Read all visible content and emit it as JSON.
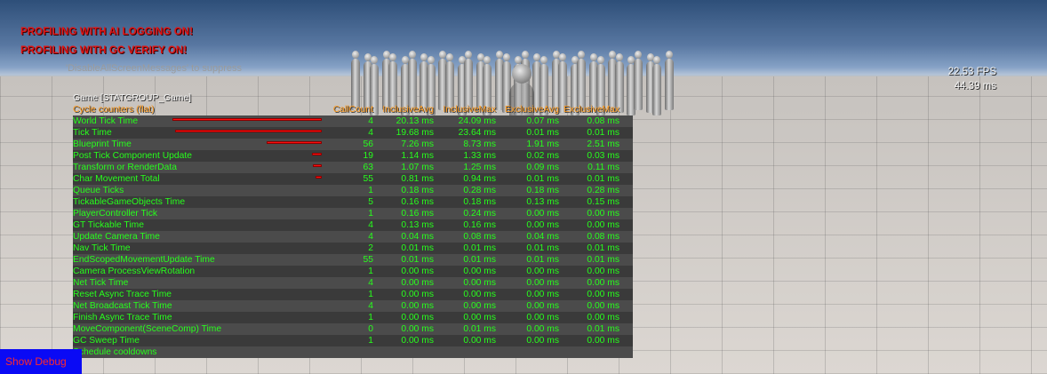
{
  "warnings": [
    "PROFILING WITH AI LOGGING ON!",
    "PROFILING WITH GC VERIFY ON!"
  ],
  "suppress_hint": "'DisableAllScreenMessages' to suppress",
  "fps": {
    "fps": "22.53 FPS",
    "ms": "44.39 ms"
  },
  "stats": {
    "group_title": "Game [STATGROUP_Game]",
    "headers": {
      "name": "Cycle counters (flat)",
      "callcount": "CallCount",
      "inclusive_avg": "InclusiveAvg",
      "inclusive_max": "InclusiveMax",
      "exclusive_avg": "ExclusiveAvg",
      "exclusive_max": "ExclusiveMax"
    },
    "colors": {
      "text": "#27ff1c",
      "header": "#ff9b1e",
      "bar": "#ff1010"
    },
    "rows": [
      {
        "name": "World Tick Time",
        "count": "4",
        "inc_avg": "20.13 ms",
        "inc_max": "24.09 ms",
        "exc_avg": "0.07 ms",
        "exc_max": "0.08 ms",
        "bar": 0.6
      },
      {
        "name": "Tick Time",
        "count": "4",
        "inc_avg": "19.68 ms",
        "inc_max": "23.64 ms",
        "exc_avg": "0.01 ms",
        "exc_max": "0.01 ms",
        "bar": 0.59
      },
      {
        "name": "Blueprint Time",
        "count": "56",
        "inc_avg": "7.26 ms",
        "inc_max": "8.73 ms",
        "exc_avg": "1.91 ms",
        "exc_max": "2.51 ms",
        "bar": 0.22
      },
      {
        "name": "Post Tick Component Update",
        "count": "19",
        "inc_avg": "1.14 ms",
        "inc_max": "1.33 ms",
        "exc_avg": "0.02 ms",
        "exc_max": "0.03 ms",
        "bar": 0.04
      },
      {
        "name": "Transform or RenderData",
        "count": "63",
        "inc_avg": "1.07 ms",
        "inc_max": "1.25 ms",
        "exc_avg": "0.09 ms",
        "exc_max": "0.11 ms",
        "bar": 0.035
      },
      {
        "name": "Char Movement Total",
        "count": "55",
        "inc_avg": "0.81 ms",
        "inc_max": "0.94 ms",
        "exc_avg": "0.01 ms",
        "exc_max": "0.01 ms",
        "bar": 0.025
      },
      {
        "name": "Queue Ticks",
        "count": "1",
        "inc_avg": "0.18 ms",
        "inc_max": "0.28 ms",
        "exc_avg": "0.18 ms",
        "exc_max": "0.28 ms"
      },
      {
        "name": "TickableGameObjects Time",
        "count": "5",
        "inc_avg": "0.16 ms",
        "inc_max": "0.18 ms",
        "exc_avg": "0.13 ms",
        "exc_max": "0.15 ms"
      },
      {
        "name": "PlayerController Tick",
        "count": "1",
        "inc_avg": "0.16 ms",
        "inc_max": "0.24 ms",
        "exc_avg": "0.00 ms",
        "exc_max": "0.00 ms"
      },
      {
        "name": "GT Tickable Time",
        "count": "4",
        "inc_avg": "0.13 ms",
        "inc_max": "0.16 ms",
        "exc_avg": "0.00 ms",
        "exc_max": "0.00 ms"
      },
      {
        "name": "Update Camera Time",
        "count": "4",
        "inc_avg": "0.04 ms",
        "inc_max": "0.08 ms",
        "exc_avg": "0.04 ms",
        "exc_max": "0.08 ms"
      },
      {
        "name": "Nav Tick Time",
        "count": "2",
        "inc_avg": "0.01 ms",
        "inc_max": "0.01 ms",
        "exc_avg": "0.01 ms",
        "exc_max": "0.01 ms"
      },
      {
        "name": "EndScopedMovementUpdate Time",
        "count": "55",
        "inc_avg": "0.01 ms",
        "inc_max": "0.01 ms",
        "exc_avg": "0.01 ms",
        "exc_max": "0.01 ms"
      },
      {
        "name": "Camera ProcessViewRotation",
        "count": "1",
        "inc_avg": "0.00 ms",
        "inc_max": "0.00 ms",
        "exc_avg": "0.00 ms",
        "exc_max": "0.00 ms"
      },
      {
        "name": "Net Tick Time",
        "count": "4",
        "inc_avg": "0.00 ms",
        "inc_max": "0.00 ms",
        "exc_avg": "0.00 ms",
        "exc_max": "0.00 ms"
      },
      {
        "name": "Reset Async Trace Time",
        "count": "1",
        "inc_avg": "0.00 ms",
        "inc_max": "0.00 ms",
        "exc_avg": "0.00 ms",
        "exc_max": "0.00 ms"
      },
      {
        "name": "Net Broadcast Tick Time",
        "count": "4",
        "inc_avg": "0.00 ms",
        "inc_max": "0.00 ms",
        "exc_avg": "0.00 ms",
        "exc_max": "0.00 ms"
      },
      {
        "name": "Finish Async Trace Time",
        "count": "1",
        "inc_avg": "0.00 ms",
        "inc_max": "0.00 ms",
        "exc_avg": "0.00 ms",
        "exc_max": "0.00 ms"
      },
      {
        "name": "MoveComponent(SceneComp) Time",
        "count": "0",
        "inc_avg": "0.00 ms",
        "inc_max": "0.01 ms",
        "exc_avg": "0.00 ms",
        "exc_max": "0.01 ms"
      },
      {
        "name": "GC Sweep Time",
        "count": "1",
        "inc_avg": "0.00 ms",
        "inc_max": "0.00 ms",
        "exc_avg": "0.00 ms",
        "exc_max": "0.00 ms"
      },
      {
        "name": "Schedule cooldowns",
        "count": "",
        "inc_avg": "",
        "inc_max": "",
        "exc_avg": "",
        "exc_max": ""
      }
    ]
  },
  "show_debug": {
    "label": "Show Debug",
    "background": "#0a0af5",
    "color": "#ff2a2a"
  }
}
